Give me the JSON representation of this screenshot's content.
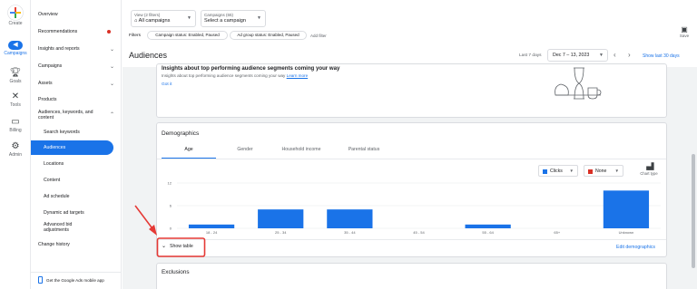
{
  "rail": {
    "create": "Create",
    "campaigns": "Campaigns",
    "goals": "Goals",
    "tools": "Tools",
    "billing": "Billing",
    "admin": "Admin"
  },
  "nav": {
    "overview": "Overview",
    "recommendations": "Recommendations",
    "insights": "Insights and reports",
    "campaigns": "Campaigns",
    "assets": "Assets",
    "products": "Products",
    "audiences_group": "Audiences, keywords, and content",
    "search_keywords": "Search keywords",
    "audiences": "Audiences",
    "locations": "Locations",
    "content": "Content",
    "ad_schedule": "Ad schedule",
    "dynamic_ad_targets": "Dynamic ad targets",
    "advanced_bid": "Advanced bid adjustments",
    "change_history": "Change history",
    "mobile_app": "Get the Google Ads mobile app"
  },
  "topbar": {
    "view_label": "View (2 filters)",
    "view_value": "All campaigns",
    "campaigns_label": "Campaigns (65)",
    "campaigns_value": "Select a campaign",
    "filters_label": "Filters",
    "filter_chips": [
      "Campaign status: Enabled, Paused",
      "Ad group status: Enabled, Paused"
    ],
    "add_filter": "Add filter",
    "save": "Save"
  },
  "header": {
    "title": "Audiences",
    "last_days": "Last 7 days",
    "date_range": "Dec 7 – 13, 2023",
    "show_last": "Show last 30 days"
  },
  "insights_card": {
    "title": "Insights about top performing audience segments coming your way",
    "body": "Insights about top performing audience segments coming your way",
    "learn_more": "Learn more",
    "got_it": "Got it"
  },
  "demographics": {
    "title": "Demographics",
    "tabs": [
      "Age",
      "Gender",
      "Household income",
      "Parental status"
    ],
    "metric1": "Clicks",
    "metric2": "None",
    "chart_type": "Chart type",
    "show_table": "Show table",
    "edit": "Edit demographics"
  },
  "exclusions": {
    "title": "Exclusions"
  },
  "colors": {
    "accent": "#1a73e8",
    "annotation": "#e53935"
  },
  "chart_data": {
    "type": "bar",
    "categories": [
      "18 - 24",
      "25 - 34",
      "35 - 44",
      "45 - 54",
      "55 - 64",
      "65+",
      "Unknown"
    ],
    "series": [
      {
        "name": "Clicks",
        "values": [
          1,
          5,
          5,
          0,
          1,
          0,
          10
        ]
      }
    ],
    "ylim": [
      0,
      12
    ],
    "yticks": [
      0,
      6,
      12
    ],
    "title": "",
    "xlabel": "",
    "ylabel": "",
    "grid": true
  }
}
